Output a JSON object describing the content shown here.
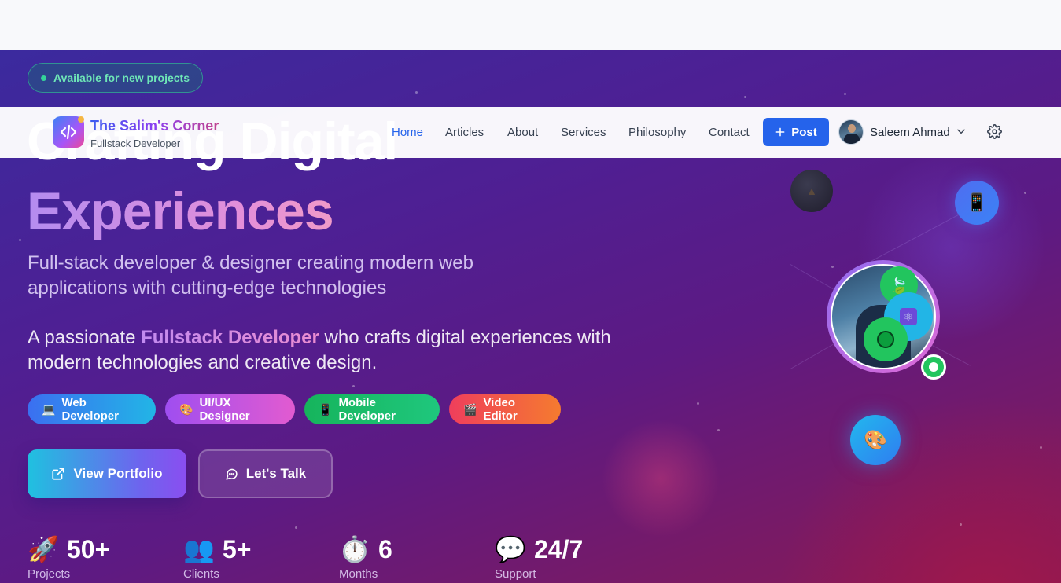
{
  "status_badge": "Available for new projects",
  "headline": {
    "line1": "Crafting Digital",
    "line2": "Experiences"
  },
  "subtitle": "Full-stack developer & designer creating modern web applications with cutting-edge technologies",
  "description": {
    "before": "A passionate ",
    "highlight": "Fullstack Developer",
    "after": " who crafts digital experiences with modern technologies and creative design."
  },
  "roles": [
    {
      "icon": "laptop-icon",
      "glyph": "💻",
      "label": "Web Developer"
    },
    {
      "icon": "palette-icon",
      "glyph": "🎨",
      "label": "UI/UX Designer"
    },
    {
      "icon": "mobile-icon",
      "glyph": "📱",
      "label": "Mobile Developer"
    },
    {
      "icon": "clapper-icon",
      "glyph": "🎬",
      "label": "Video Editor"
    }
  ],
  "cta": {
    "portfolio": "View Portfolio",
    "talk": "Let's Talk"
  },
  "stats": [
    {
      "icon": "rocket-icon",
      "glyph": "🚀",
      "value": "50+",
      "label": "Projects"
    },
    {
      "icon": "clients-icon",
      "glyph": "👥",
      "value": "5+",
      "label": "Clients"
    },
    {
      "icon": "stopwatch-icon",
      "glyph": "⏱️",
      "value": "6",
      "label": "Months"
    },
    {
      "icon": "chat-icon",
      "glyph": "💬",
      "value": "24/7",
      "label": "Support"
    }
  ],
  "floating": {
    "tablet": "📱",
    "palette": "🎨",
    "leaf": "🍃",
    "react": "⚛"
  },
  "navbar": {
    "brand": "The Salim's Corner",
    "brand_sub": "Fullstack Developer",
    "items": [
      "Home",
      "Articles",
      "About",
      "Services",
      "Philosophy",
      "Contact"
    ],
    "post_label": "Post",
    "user_name": "Saleem Ahmad"
  },
  "colors": {
    "accent": "#2563eb",
    "online": "#22c55e",
    "badge_text": "#6ee7b7"
  }
}
